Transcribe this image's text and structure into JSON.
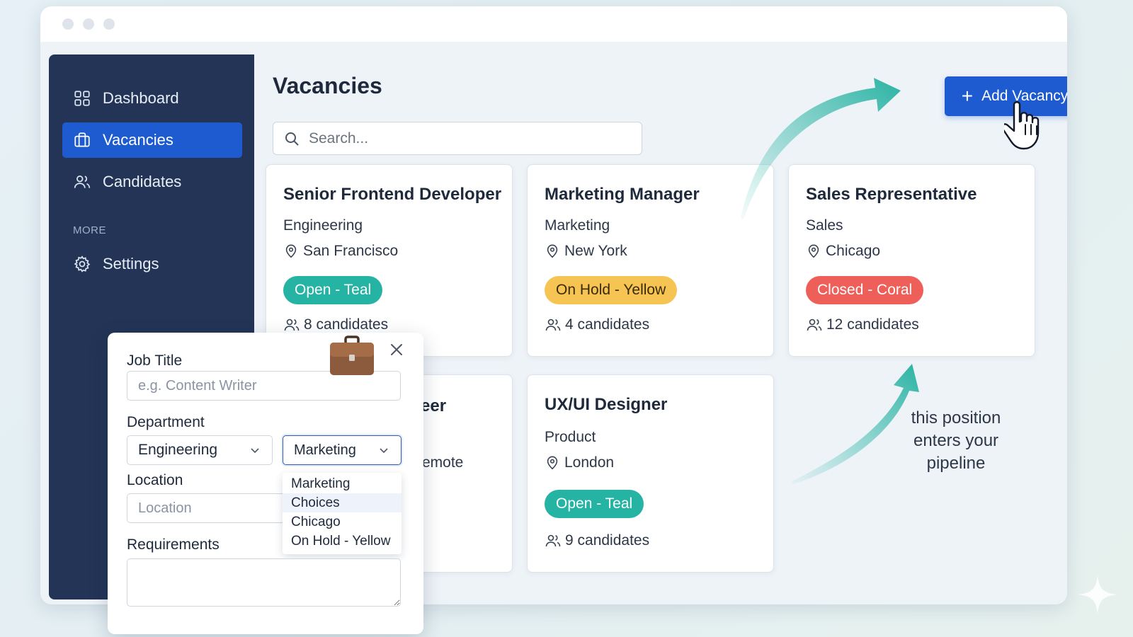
{
  "sidebar": {
    "items": [
      {
        "label": "Dashboard",
        "icon": "grid-icon"
      },
      {
        "label": "Vacancies",
        "icon": "briefcase-icon",
        "active": true
      },
      {
        "label": "Candidates",
        "icon": "users-icon"
      }
    ],
    "section_label": "MORE",
    "more_items": [
      {
        "label": "Settings",
        "icon": "gear-icon"
      }
    ]
  },
  "header": {
    "title": "Vacancies",
    "add_button_label": "Add Vacancy",
    "search_placeholder": "Search..."
  },
  "cards": [
    {
      "title": "Senior Frontend Developer",
      "department": "Engineering",
      "location": "San Francisco",
      "status": "Open - Teal",
      "candidates": "8 candidates"
    },
    {
      "title": "Marketing Manager",
      "department": "Marketing",
      "location": "New York",
      "status": "On Hold - Yellow",
      "candidates": "4 candidates"
    },
    {
      "title": "Sales Representative",
      "department": "Sales",
      "location": "Chicago",
      "status": "Closed - Coral",
      "candidates": "12 candidates"
    },
    {
      "title_fragment": "eer",
      "location_fragment": "emote"
    },
    {
      "title": "UX/UI Designer",
      "department": "Product",
      "location": "London",
      "status": "Open - Teal",
      "candidates": "9 candidates"
    }
  ],
  "status_colors": {
    "teal": "#25b3a3",
    "yellow": "#f6c453",
    "coral": "#ef5f5a"
  },
  "accent_color": "#1f5bd0",
  "annotation": "this position enters your pipeline",
  "modal": {
    "job_title_label": "Job Title",
    "job_title_placeholder": "e.g. Content Writer",
    "department_label": "Department",
    "department_value": "Engineering",
    "department_second_value": "Marketing",
    "dropdown_options": [
      "Marketing",
      "Choices",
      "Chicago",
      "On Hold - Yellow"
    ],
    "location_label": "Location",
    "location_placeholder": "Location",
    "requirements_label": "Requirements"
  }
}
